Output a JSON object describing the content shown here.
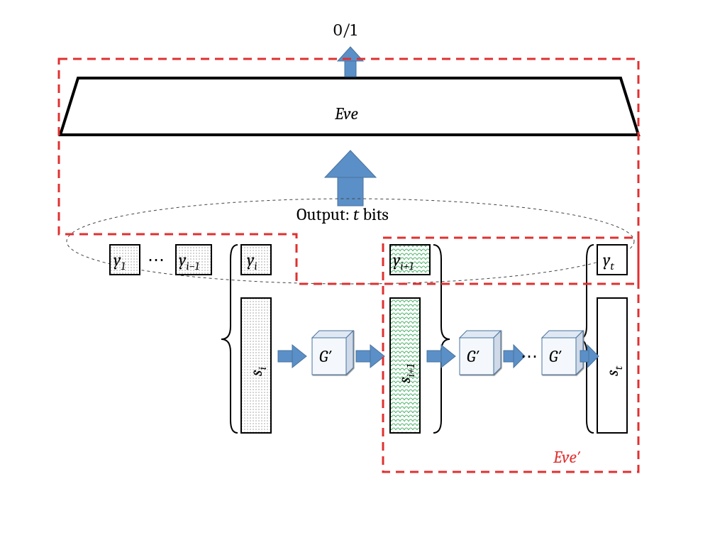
{
  "output_label": "0/1",
  "eve_label": "Eve",
  "eve_prime_label": "Eve′",
  "ellipse_label": "Output: t bits",
  "y": {
    "1": "y",
    "im1": "y",
    "i": "y",
    "ip1": "y",
    "t": "y"
  },
  "ysub": {
    "1": "1",
    "im1": "i−1",
    "i": "i",
    "ip1": "i+1",
    "t": "t"
  },
  "s": {
    "i": "s",
    "ip1": "s",
    "t": "s"
  },
  "ssub": {
    "i": "i",
    "ip1": "i+1",
    "t": "t"
  },
  "g": "G′",
  "dots": "⋯",
  "colors": {
    "arrow": "#5B8FC7",
    "dash": "#E03030",
    "green": "#9FDCA6"
  }
}
